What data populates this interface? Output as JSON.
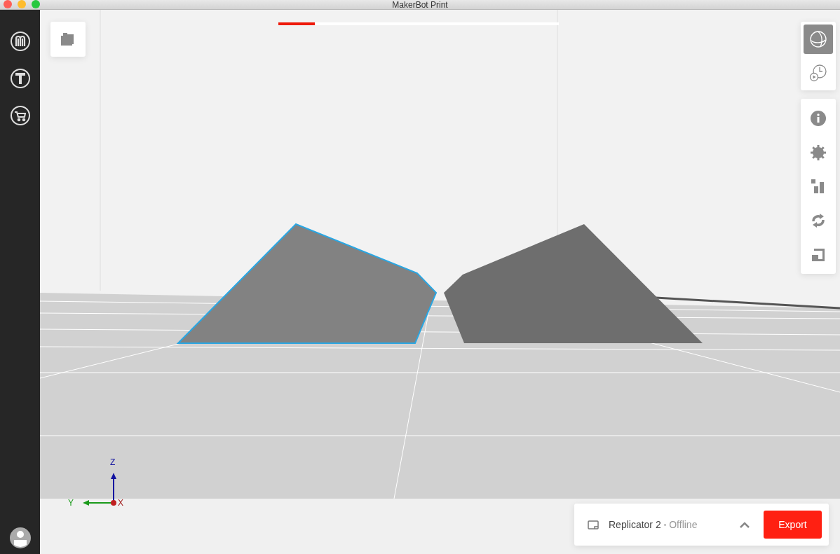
{
  "window": {
    "title": "MakerBot Print"
  },
  "progress": {
    "level": 0.13
  },
  "view_buttons": [
    {
      "kind": "globe",
      "selected": true
    },
    {
      "kind": "clock",
      "selected": false
    }
  ],
  "axes": {
    "z": "Z",
    "y": "Y",
    "x": "X"
  },
  "printer": {
    "name": "Replicator 2",
    "separator": "•",
    "status": "Offline"
  },
  "export_button": "Export"
}
